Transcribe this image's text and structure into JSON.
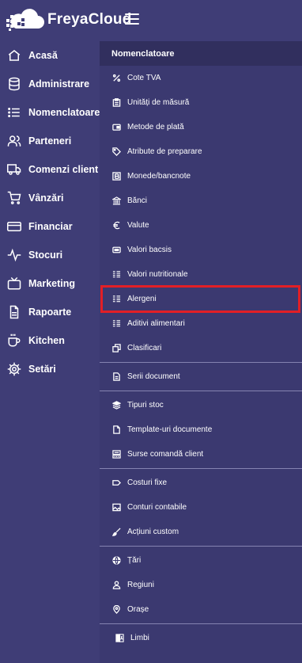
{
  "brand": {
    "name": "FreyaCloud"
  },
  "main_nav": [
    {
      "label": "Acasă",
      "icon": "home-icon"
    },
    {
      "label": "Administrare",
      "icon": "database-icon"
    },
    {
      "label": "Nomenclatoare",
      "icon": "list-icon"
    },
    {
      "label": "Parteneri",
      "icon": "users-icon"
    },
    {
      "label": "Comenzi client",
      "icon": "truck-icon"
    },
    {
      "label": "Vânzări",
      "icon": "cart-icon"
    },
    {
      "label": "Financiar",
      "icon": "credit-card-icon"
    },
    {
      "label": "Stocuri",
      "icon": "activity-icon"
    },
    {
      "label": "Marketing",
      "icon": "tv-icon"
    },
    {
      "label": "Rapoarte",
      "icon": "file-text-icon"
    },
    {
      "label": "Kitchen",
      "icon": "coffee-icon"
    },
    {
      "label": "Setări",
      "icon": "settings-icon"
    }
  ],
  "submenu": {
    "title": "Nomenclatoare",
    "items": [
      {
        "label": "Cote TVA",
        "icon": "percent-icon"
      },
      {
        "label": "Unități de măsură",
        "icon": "clipboard-icon"
      },
      {
        "label": "Metode de plată",
        "icon": "wallet-icon"
      },
      {
        "label": "Atribute de preparare",
        "icon": "tag-icon"
      },
      {
        "label": "Monede/bancnote",
        "icon": "currency-icon"
      },
      {
        "label": "Bănci",
        "icon": "bank-icon"
      },
      {
        "label": "Valute",
        "icon": "euro-icon"
      },
      {
        "label": "Valori bacsis",
        "icon": "money-icon"
      },
      {
        "label": "Valori nutritionale",
        "icon": "lines-icon"
      },
      {
        "label": "Alergeni",
        "icon": "lines-icon"
      },
      {
        "label": "Aditivi alimentari",
        "icon": "lines-icon"
      },
      {
        "label": "Clasificari",
        "icon": "clone-icon"
      },
      {
        "label": "Serii document",
        "icon": "document-icon"
      },
      {
        "label": "Tipuri stoc",
        "icon": "layers-icon"
      },
      {
        "label": "Template-uri documente",
        "icon": "file-icon"
      },
      {
        "label": "Surse comandă client",
        "icon": "register-icon"
      },
      {
        "label": "Costuri fixe",
        "icon": "label-icon"
      },
      {
        "label": "Conturi contabile",
        "icon": "image-icon"
      },
      {
        "label": "Acțiuni custom",
        "icon": "brush-icon"
      },
      {
        "label": "Țări",
        "icon": "globe-icon"
      },
      {
        "label": "Regiuni",
        "icon": "person-icon"
      },
      {
        "label": "Orașe",
        "icon": "location-icon"
      },
      {
        "label": "Limbi",
        "icon": "language-icon"
      }
    ],
    "selected": "Alergeni"
  },
  "colors": {
    "background": "#3f3d76",
    "submenu_header": "#312f5e",
    "highlight": "#e21f26",
    "text": "#ffffff"
  }
}
